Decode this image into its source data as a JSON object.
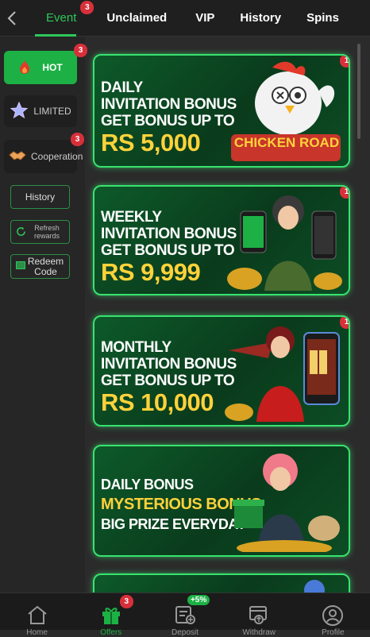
{
  "header": {
    "tabs": [
      {
        "label": "Event",
        "badge": "3",
        "active": true
      },
      {
        "label": "Unclaimed"
      },
      {
        "label": "VIP"
      },
      {
        "label": "History"
      },
      {
        "label": "Spins"
      }
    ]
  },
  "sidebar": {
    "hot": {
      "label": "HOT",
      "badge": "3"
    },
    "limited": {
      "label": "LIMITED"
    },
    "cooperation": {
      "label": "Cooperation",
      "badge": "3"
    },
    "history": {
      "label": "History"
    },
    "refresh": {
      "label": "Refresh rewards"
    },
    "redeem": {
      "label": "Redeem Code"
    }
  },
  "cards": [
    {
      "line1": "DAILY",
      "line2": "INVITATION BONUS",
      "line3": "GET BONUS UP TO",
      "amount": "RS 5,000",
      "badge": "1",
      "art": "CHICKEN ROAD"
    },
    {
      "line1": "WEEKLY",
      "line2": "INVITATION BONUS",
      "line3": "GET BONUS UP TO",
      "amount": "RS 9,999",
      "badge": "1"
    },
    {
      "line1": "MONTHLY",
      "line2": "INVITATION BONUS",
      "line3": "GET BONUS UP TO",
      "amount": "RS 10,000",
      "badge": "1"
    },
    {
      "line1": "DAILY BONUS",
      "line2": "MYSTERIOUS BONUS",
      "line3": "BIG PRIZE EVERYDAY"
    }
  ],
  "bottom_nav": [
    {
      "label": "Home",
      "icon": "home-icon"
    },
    {
      "label": "Offers",
      "icon": "gift-icon",
      "badge": "3",
      "active": true
    },
    {
      "label": "Deposit",
      "icon": "deposit-icon",
      "badge": "+5%"
    },
    {
      "label": "Withdraw",
      "icon": "withdraw-icon"
    },
    {
      "label": "Profile",
      "icon": "profile-icon"
    }
  ],
  "colors": {
    "accent": "#2ec75a",
    "badge": "#d8303a",
    "amount": "#ffd23a"
  }
}
